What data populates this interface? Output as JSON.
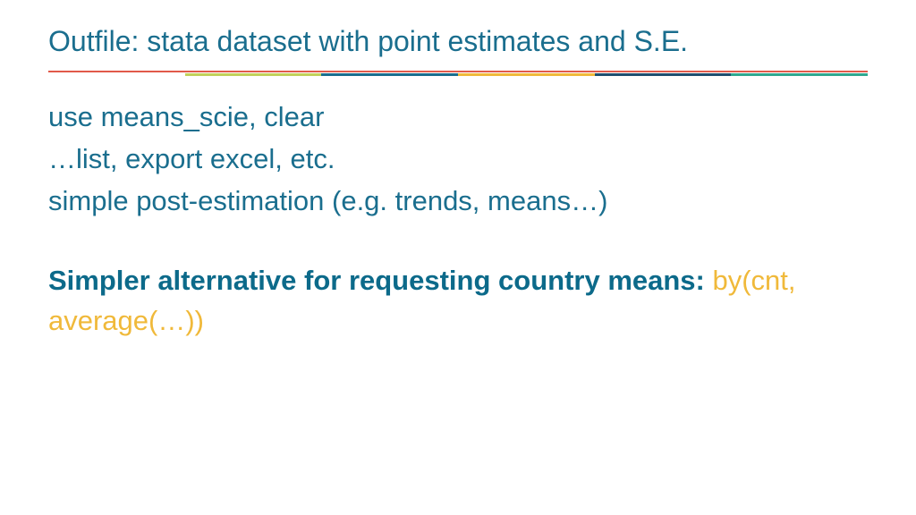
{
  "title": "Outfile: stata dataset with point estimates and S.E.",
  "lines": {
    "l1": "use means_scie, clear",
    "l2": "…list, export excel, etc.",
    "l3": "simple post-estimation (e.g. trends, means…)"
  },
  "alt": {
    "bold": "Simpler alternative for requesting country means: ",
    "code": "by(cnt, average(…))"
  }
}
